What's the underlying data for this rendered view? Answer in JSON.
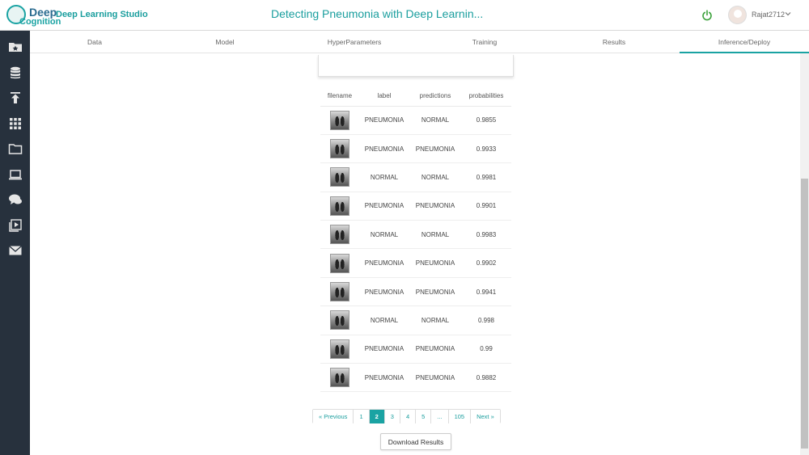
{
  "header": {
    "logo_line1": "Deep",
    "logo_line2": "Cognition",
    "app_name": "Deep Learning Studio",
    "project_title": "Detecting Pneumonia with Deep Learnin...",
    "username": "Rajat2712"
  },
  "sidebar": {
    "items": [
      "folder-star-icon",
      "database-icon",
      "upload-icon",
      "grid-icon",
      "folder-icon",
      "laptop-icon",
      "chat-icon",
      "video-icon",
      "mail-icon"
    ]
  },
  "tabs": [
    "Data",
    "Model",
    "HyperParameters",
    "Training",
    "Results",
    "Inference/Deploy"
  ],
  "active_tab": "Inference/Deploy",
  "table": {
    "headers": [
      "filename",
      "label",
      "predictions",
      "probabilities"
    ],
    "rows": [
      {
        "label": "PNEUMONIA",
        "prediction": "NORMAL",
        "probability": "0.9855"
      },
      {
        "label": "PNEUMONIA",
        "prediction": "PNEUMONIA",
        "probability": "0.9933"
      },
      {
        "label": "NORMAL",
        "prediction": "NORMAL",
        "probability": "0.9981"
      },
      {
        "label": "PNEUMONIA",
        "prediction": "PNEUMONIA",
        "probability": "0.9901"
      },
      {
        "label": "NORMAL",
        "prediction": "NORMAL",
        "probability": "0.9983"
      },
      {
        "label": "PNEUMONIA",
        "prediction": "PNEUMONIA",
        "probability": "0.9902"
      },
      {
        "label": "PNEUMONIA",
        "prediction": "PNEUMONIA",
        "probability": "0.9941"
      },
      {
        "label": "NORMAL",
        "prediction": "NORMAL",
        "probability": "0.998"
      },
      {
        "label": "PNEUMONIA",
        "prediction": "PNEUMONIA",
        "probability": "0.99"
      },
      {
        "label": "PNEUMONIA",
        "prediction": "PNEUMONIA",
        "probability": "0.9882"
      }
    ]
  },
  "pagination": {
    "previous": "« Previous",
    "pages": [
      "1",
      "2",
      "3",
      "4",
      "5",
      "...",
      "105"
    ],
    "current": "2",
    "next": "Next »"
  },
  "download_label": "Download Results",
  "colors": {
    "accent": "#1aa3a3",
    "sidebar": "#27313d",
    "power": "#3aa13a"
  }
}
